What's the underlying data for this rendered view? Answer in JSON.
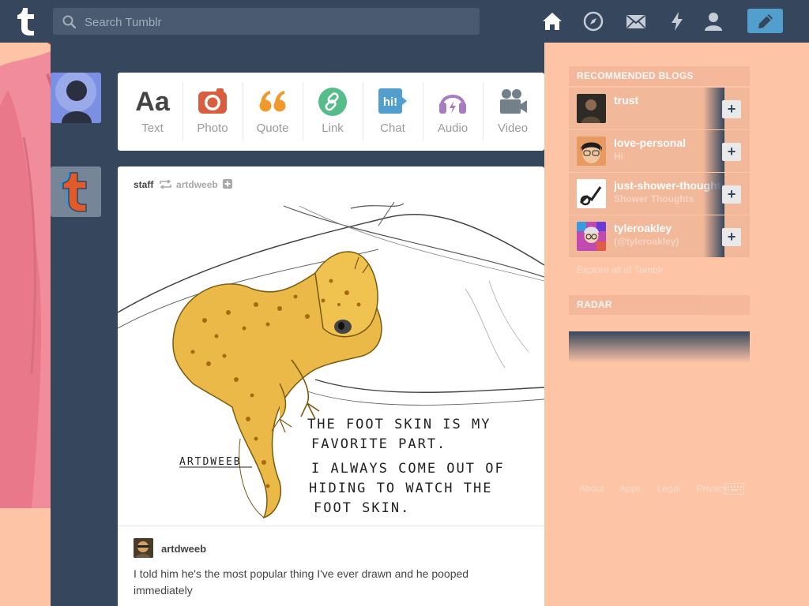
{
  "header": {
    "search_placeholder": "Search Tumblr",
    "nav_icons": [
      "home-icon",
      "explore-icon",
      "inbox-icon",
      "activity-icon",
      "account-icon"
    ],
    "compose_icon": "pencil-icon"
  },
  "post_types": [
    {
      "label": "Text",
      "glyph": "Aa",
      "color": "#444444"
    },
    {
      "label": "Photo",
      "color": "#d95e40"
    },
    {
      "label": "Quote",
      "glyph": "““",
      "color": "#f2992e"
    },
    {
      "label": "Link",
      "color": "#56bc8a"
    },
    {
      "label": "Chat",
      "glyph": "hi!",
      "color": "#529ecc"
    },
    {
      "label": "Audio",
      "color": "#a77dc2"
    },
    {
      "label": "Video",
      "color": "#748089"
    }
  ],
  "post": {
    "author": "staff",
    "reblogged_from": "artdweeb",
    "drawing_text": {
      "signature": "ARTDWEEB",
      "line1": "THE FOOT SKIN IS MY",
      "line2": "FAVORITE PART.",
      "line3": "I ALWAYS COME OUT OF",
      "line4": "HIDING TO WATCH THE",
      "line5": "FOOT SKIN."
    },
    "source_name": "artdweeb",
    "caption": "I told him he's the most popular thing I've ever drawn and he pooped immediately"
  },
  "sidebar": {
    "recommended_title": "RECOMMENDED BLOGS",
    "blogs": [
      {
        "name": "trust",
        "subtitle": ""
      },
      {
        "name": "love-personal",
        "subtitle": "Hi"
      },
      {
        "name": "just-shower-thoughts",
        "subtitle": "Shower Thoughts"
      },
      {
        "name": "tyleroakley",
        "subtitle": "(@tyleroakley)"
      }
    ],
    "follow_glyph": "+",
    "explore_link": "Explore all of Tumblr",
    "radar_title": "RADAR"
  },
  "footer": {
    "links": [
      "About",
      "Apps",
      "Legal",
      "Privacy"
    ]
  },
  "colors": {
    "navy": "#36465d",
    "background": "#fdc5a6",
    "accent_blue": "#529ecc"
  }
}
